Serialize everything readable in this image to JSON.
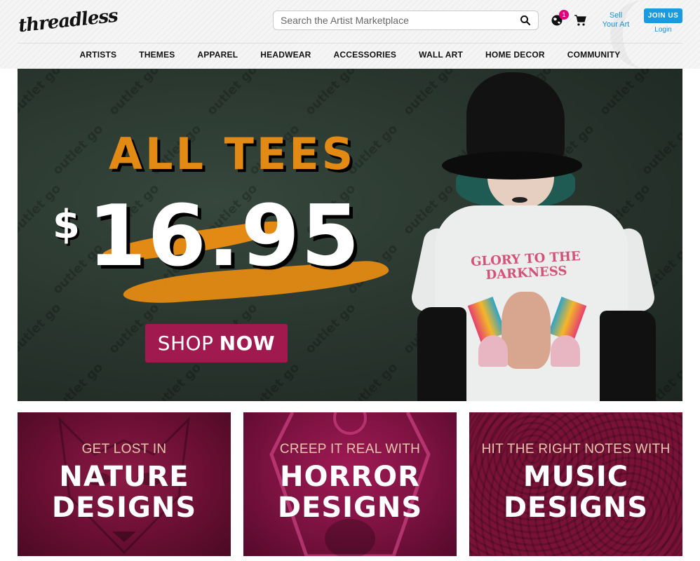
{
  "header": {
    "logo_text": "threadless",
    "search": {
      "placeholder": "Search the Artist Marketplace"
    },
    "icons": {
      "search": "search-icon",
      "globe": "globe-icon",
      "cart": "cart-icon"
    },
    "notification_count": "1",
    "sell_line1": "Sell",
    "sell_line2": "Your Art",
    "join_label": "JOIN US",
    "login_label": "Login"
  },
  "nav": {
    "items": [
      "ARTISTS",
      "THEMES",
      "APPAREL",
      "HEADWEAR",
      "ACCESSORIES",
      "WALL ART",
      "HOME DECOR",
      "COMMUNITY"
    ]
  },
  "hero": {
    "headline": "ALL TEES",
    "currency": "$",
    "price": "16.95",
    "cta_light": "SHOP",
    "cta_bold": "NOW",
    "watermark": "outlet go",
    "shirt_print": "GLORY TO THE DARKNESS"
  },
  "tiles": [
    {
      "subtitle": "GET LOST IN",
      "title_line1": "NATURE",
      "title_line2": "DESIGNS"
    },
    {
      "subtitle": "CREEP IT REAL WITH",
      "title_line1": "HORROR",
      "title_line2": "DESIGNS"
    },
    {
      "subtitle": "HIT THE RIGHT NOTES WITH",
      "title_line1": "MUSIC",
      "title_line2": "DESIGNS"
    }
  ],
  "colors": {
    "accent_blue": "#1a9be0",
    "badge_pink": "#e4007c",
    "hero_orange": "#e38a14",
    "cta_magenta": "#a11a4f",
    "tile_magenta": "#7a1238"
  }
}
